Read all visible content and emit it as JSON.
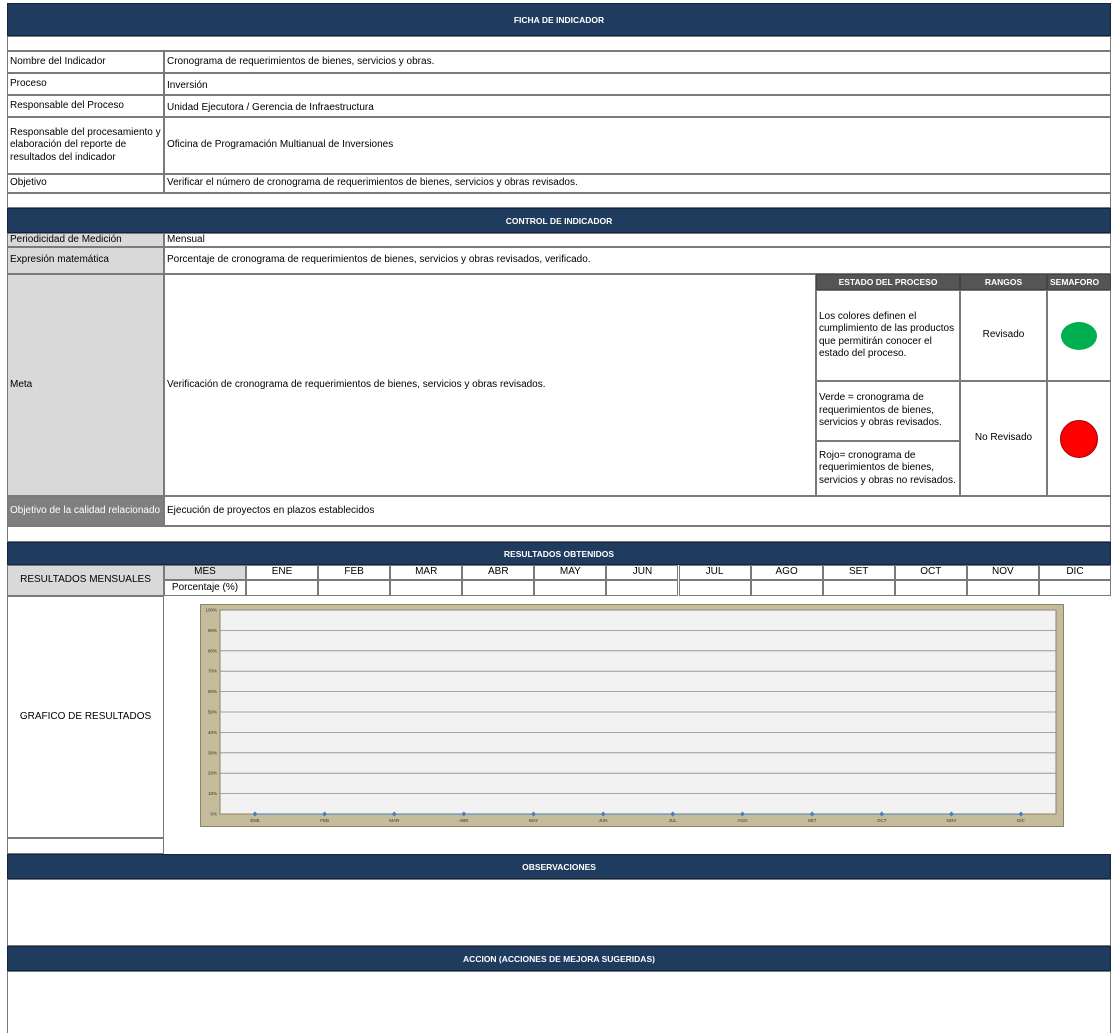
{
  "ficha": {
    "title": "FICHA DE INDICADOR",
    "rows": [
      {
        "label": "Nombre del Indicador",
        "value": "Cronograma de requerimientos de bienes, servicios y obras."
      },
      {
        "label": "Proceso",
        "value": "Inversión"
      },
      {
        "label": "Responsable del Proceso",
        "value": "Unidad Ejecutora / Gerencia de Infraestructura"
      },
      {
        "label": "Responsable del procesamiento y elaboración del reporte de resultados del indicador",
        "value": "Oficina de Programación Multianual de Inversiones"
      },
      {
        "label": "Objetivo",
        "value": "Verificar el número de cronograma de requerimientos de bienes, servicios y obras revisados."
      }
    ]
  },
  "control": {
    "title": "CONTROL DE INDICADOR",
    "periodicidad_label": "Periodicidad de Medición",
    "periodicidad_value": "Mensual",
    "expresion_label": "Expresión matemática",
    "expresion_value": "Porcentaje de cronograma de requerimientos de bienes, servicios y obras revisados, verificado.",
    "meta_label": "Meta",
    "meta_value": "Verificación  de cronograma de requerimientos de bienes, servicios y obras revisados.",
    "estado_header": "ESTADO DEL PROCESO",
    "rangos_header": "RANGOS",
    "semaforo_header": "SEMAFORO",
    "estado_desc": "Los colores definen el cumplimiento de las productos que permitirán conocer el estado del proceso.",
    "verde_desc": "Verde =  cronograma de requerimientos de bienes, servicios y obras revisados.",
    "rojo_desc": "Rojo=  cronograma de requerimientos de bienes, servicios y obras no revisados.",
    "rango_revisado": "Revisado",
    "rango_no_revisado": "No Revisado",
    "green_color": "#00b050",
    "red_color": "#ff0000",
    "calidad_label": "Objetivo de la calidad relacionado",
    "calidad_value": "Ejecución de proyectos en plazos establecidos"
  },
  "resultados": {
    "title": "RESULTADOS OBTENIDOS",
    "mensuales_label": "RESULTADOS MENSUALES",
    "mes_label": "MES",
    "porcentaje_label": "Porcentaje (%)",
    "months": [
      "ENE",
      "FEB",
      "MAR",
      "ABR",
      "MAY",
      "JUN",
      "JUL",
      "AGO",
      "SET",
      "OCT",
      "NOV",
      "DIC"
    ],
    "grafico_label": "GRAFICO DE RESULTADOS"
  },
  "chart_data": {
    "type": "line",
    "categories": [
      "ENE",
      "FEB",
      "MAR",
      "ABR",
      "MAY",
      "JUN",
      "JUL",
      "AGO",
      "SET",
      "OCT",
      "NOV",
      "DIC"
    ],
    "series": [
      {
        "values": [
          0,
          0,
          0,
          0,
          0,
          0,
          0,
          0,
          0,
          0,
          0,
          0
        ]
      }
    ],
    "yticks": [
      "0%",
      "10%",
      "20%",
      "30%",
      "40%",
      "50%",
      "60%",
      "70%",
      "80%",
      "90%",
      "100%"
    ],
    "ylim": [
      0,
      100
    ],
    "grid": true,
    "marker_color": "#4a7ebb"
  },
  "observaciones": {
    "title": "OBSERVACIONES"
  },
  "accion": {
    "title": "ACCION (ACCIONES DE MEJORA SUGERIDAS)"
  }
}
